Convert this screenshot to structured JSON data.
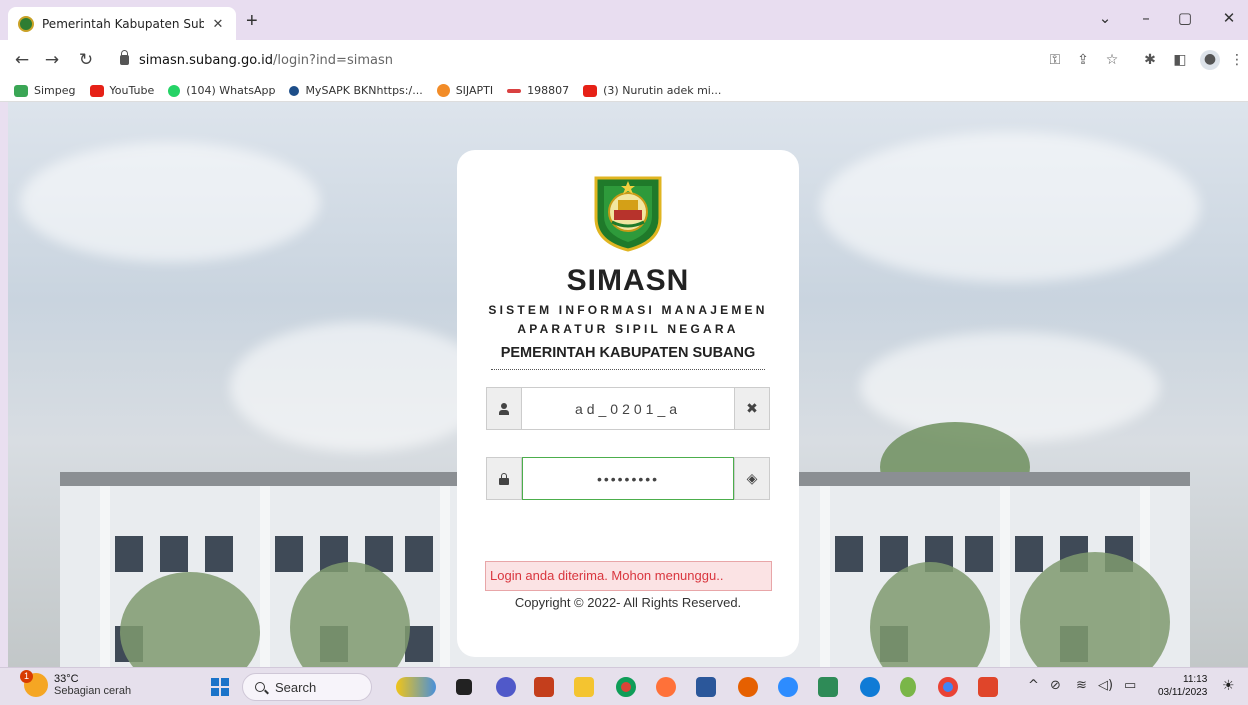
{
  "browser": {
    "tab_title": "Pemerintah Kabupaten Subang |",
    "tab_close": "✕",
    "new_tab": "+",
    "url_host": "simasn.subang.go.id",
    "url_path": "/login?ind=simasn",
    "window_controls": [
      "⌄",
      "–",
      "▢",
      "✕"
    ],
    "bookmarks": [
      {
        "label": "Simpeg",
        "icon": "simpeg-icon",
        "color": "#3aa655"
      },
      {
        "label": "YouTube",
        "icon": "youtube-icon",
        "color": "#e62117"
      },
      {
        "label": "(104) WhatsApp",
        "icon": "whatsapp-icon",
        "color": "#25d366"
      },
      {
        "label": "MySAPK BKNhttps:/...",
        "icon": "mysapk-icon",
        "color": "#1d4e89"
      },
      {
        "label": "SIJAPTI",
        "icon": "sijapti-icon",
        "color": "#f28c28"
      },
      {
        "label": "198807",
        "icon": "bkn-icon",
        "color": "#d94141"
      },
      {
        "label": "(3) Nurutin adek mi...",
        "icon": "youtube-icon",
        "color": "#e62117"
      }
    ]
  },
  "login": {
    "brand": "SIMASN",
    "tagline_line1": "SISTEM INFORMASI MANAJEMEN",
    "tagline_line2": "APARATUR SIPIL NEGARA",
    "agency": "PEMERINTAH KABUPATEN SUBANG",
    "username_value": "ad_0201_a",
    "password_value": "•••••••••",
    "status_message": "Login anda diterima. Mohon menunggu..",
    "copyright": "Copyright © 2022- All Rights Reserved."
  },
  "taskbar": {
    "weather_temp": "33°C",
    "weather_desc": "Sebagian cerah",
    "weather_badge": "1",
    "search_label": "Search",
    "time": "11:13",
    "date": "03/11/2023"
  },
  "colors": {
    "accent_green": "#4cae4c",
    "error_text": "#d9363e",
    "error_bg": "#fbe3e4"
  }
}
